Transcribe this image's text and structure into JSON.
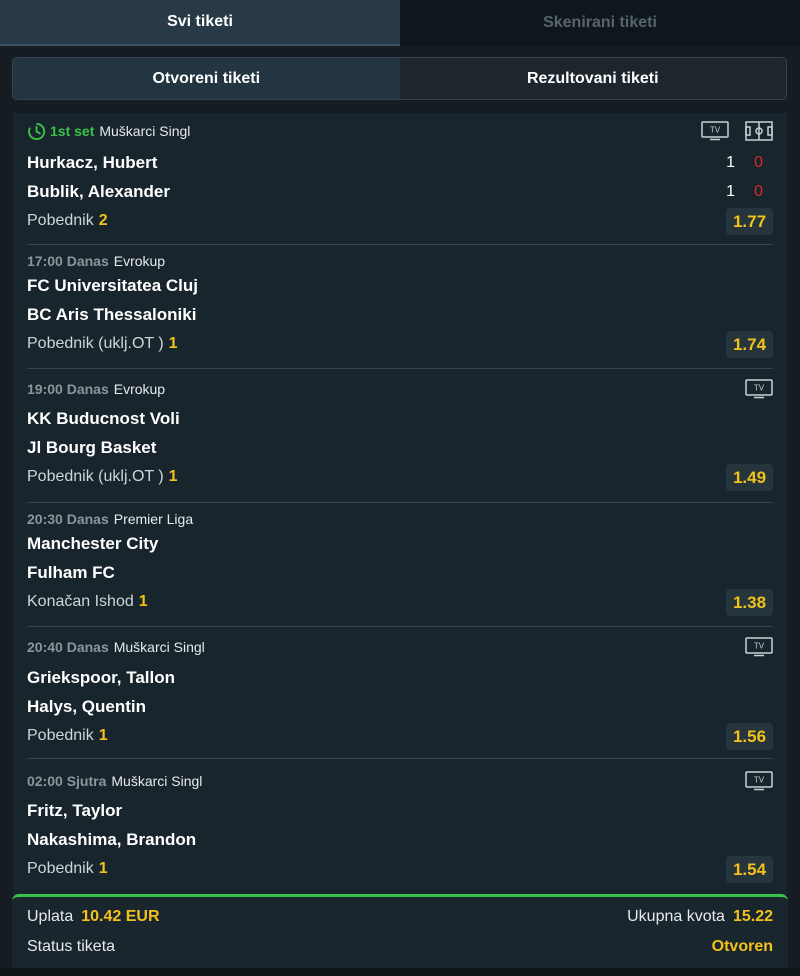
{
  "tabs": {
    "all": "Svi tiketi",
    "scanned": "Skenirani tiketi"
  },
  "subtabs": {
    "open": "Otvoreni tiketi",
    "resolved": "Rezultovani tiketi"
  },
  "matches": [
    {
      "live": "1st set",
      "time": "",
      "day": "",
      "league": "Muškarci Singl",
      "home": "Hurkacz, Hubert",
      "away": "Bublik, Alexander",
      "home_set": "1",
      "home_game": "0",
      "away_set": "1",
      "away_game": "0",
      "market": "Pobednik",
      "pick": "2",
      "odd": "1.77",
      "tv": true,
      "field": true
    },
    {
      "time": "17:00",
      "day": "Danas",
      "league": "Evrokup",
      "home": "FC Universitatea Cluj",
      "away": "BC Aris Thessaloniki",
      "market": "Pobednik (uklj.OT )",
      "pick": "1",
      "odd": "1.74",
      "tv": false
    },
    {
      "time": "19:00",
      "day": "Danas",
      "league": "Evrokup",
      "home": "KK Buducnost Voli",
      "away": "Jl Bourg Basket",
      "market": "Pobednik (uklj.OT )",
      "pick": "1",
      "odd": "1.49",
      "tv": true
    },
    {
      "time": "20:30",
      "day": "Danas",
      "league": "Premier Liga",
      "home": "Manchester City",
      "away": "Fulham FC",
      "market": "Konačan Ishod",
      "pick": "1",
      "odd": "1.38",
      "tv": false
    },
    {
      "time": "20:40",
      "day": "Danas",
      "league": "Muškarci Singl",
      "home": "Griekspoor, Tallon",
      "away": "Halys, Quentin",
      "market": "Pobednik",
      "pick": "1",
      "odd": "1.56",
      "tv": true
    },
    {
      "time": "02:00",
      "day": "Sjutra",
      "league": "Muškarci Singl",
      "home": "Fritz, Taylor",
      "away": "Nakashima, Brandon",
      "market": "Pobednik",
      "pick": "1",
      "odd": "1.54",
      "tv": true
    }
  ],
  "footer": {
    "stake_label": "Uplata",
    "stake_value": "10.42 EUR",
    "total_odds_label": "Ukupna kvota",
    "total_odds_value": "15.22",
    "status_label": "Status tiketa",
    "status_value": "Otvoren"
  },
  "icons": {
    "tv": "tv-icon",
    "field": "field-icon",
    "clock": "live-clock-icon"
  },
  "colors": {
    "accent_yellow": "#f2c21b",
    "live_green": "#39c24a",
    "score_red": "#d8262c"
  }
}
